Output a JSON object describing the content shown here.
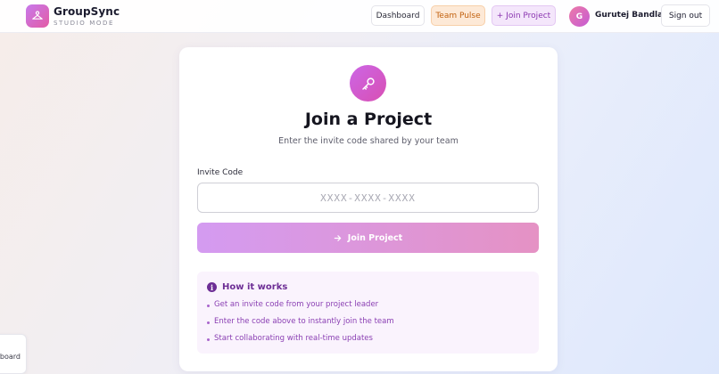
{
  "brand": {
    "name": "GroupSync",
    "subtitle": "STUDIO MODE",
    "logo_icon": "hanger-icon",
    "accent_gradient": [
      "#c779ec",
      "#e35ba4"
    ]
  },
  "nav": {
    "dashboard": "Dashboard",
    "team_pulse": "Team Pulse",
    "join_project": "+ Join Project"
  },
  "user": {
    "initial": "G",
    "name": "Gurutej Bandla"
  },
  "signout": "Sign out",
  "card": {
    "icon": "key-icon",
    "title": "Join a Project",
    "subtitle": "Enter the invite code shared by your team",
    "field_label": "Invite Code",
    "input_placeholder": "XXXX-XXXX-XXXX",
    "input_value": "",
    "button_icon": "arrow-right-icon",
    "button_label": "Join Project"
  },
  "how_it_works": {
    "icon": "info-icon",
    "title": "How it works",
    "steps": [
      "Get an invite code from your project leader",
      "Enter the code above to instantly join the team",
      "Start collaborating with real-time updates"
    ]
  },
  "side_tab": {
    "label": "ashboard"
  },
  "colors": {
    "team_pulse_bg": "#fde9d7",
    "team_pulse_text": "#c2610f",
    "join_project_bg": "#f4e6fb",
    "join_project_text": "#8a35b0",
    "info_title": "#6d2e95"
  }
}
